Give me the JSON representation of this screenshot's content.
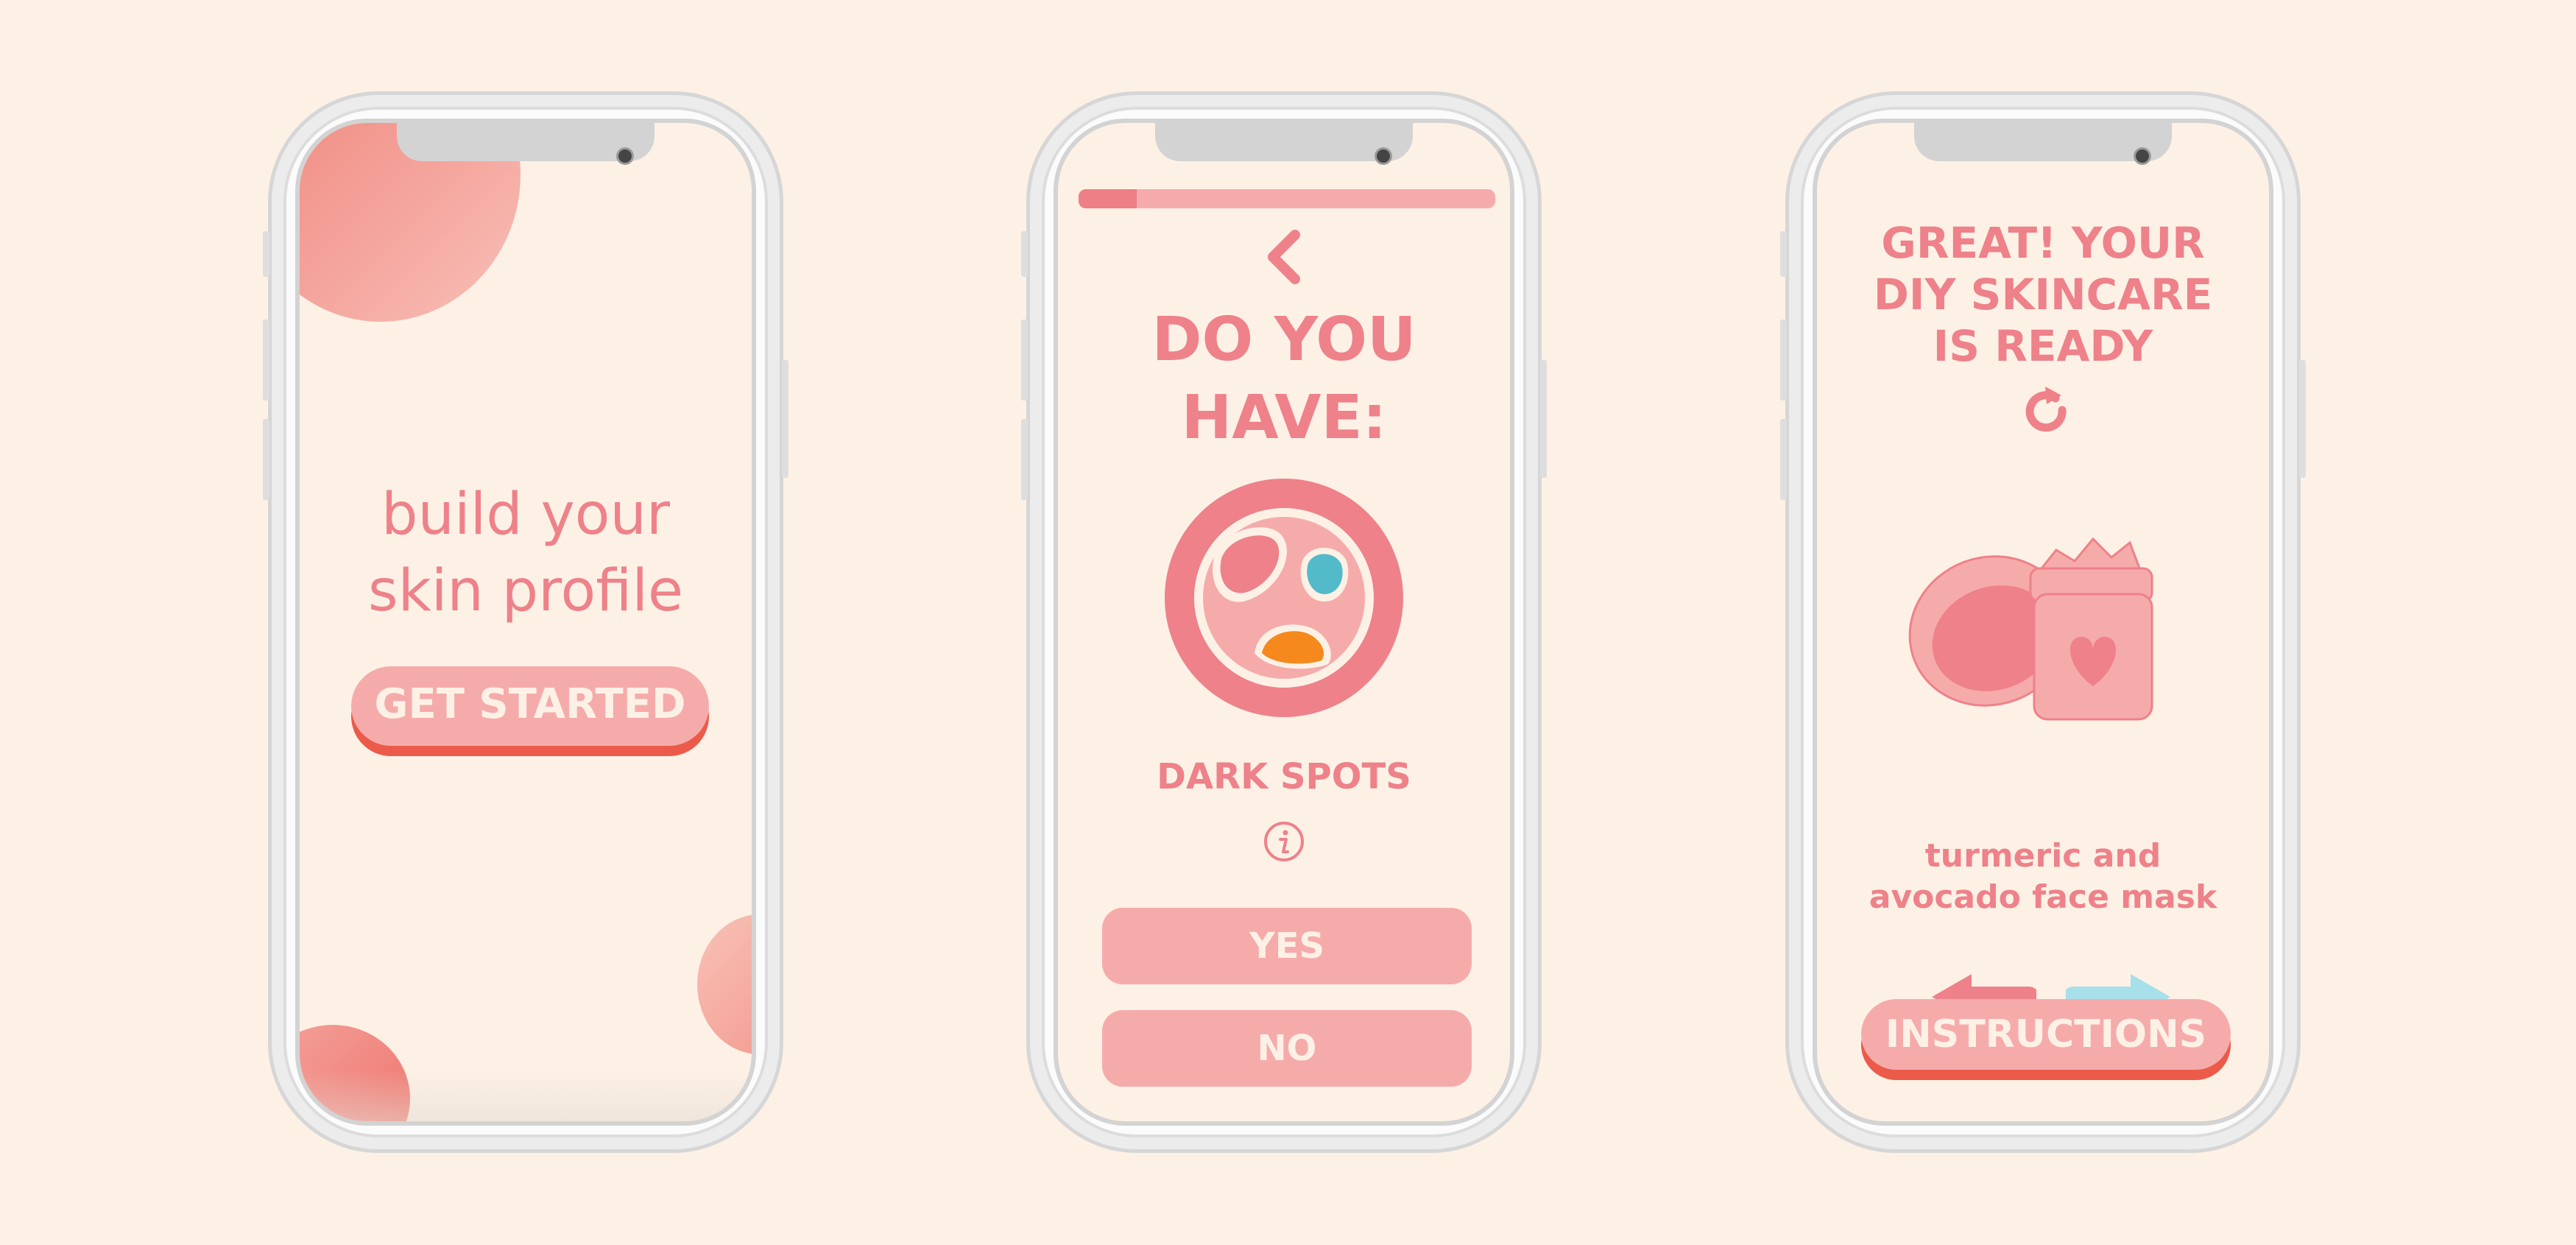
{
  "colors": {
    "background": "#fdf1e6",
    "primary_pink": "#ee8189",
    "light_pink": "#f6abab",
    "accent_red": "#ec5a4a",
    "accent_blue": "#a7dfea",
    "accent_orange": "#f5891e",
    "accent_teal": "#52bac9"
  },
  "screen1": {
    "headline_line1": "build your",
    "headline_line2": "skin profile",
    "cta_label": "GET STARTED"
  },
  "screen2": {
    "progress": 0.14,
    "back_icon": "chevron-left-icon",
    "question_line1": "DO YOU",
    "question_line2": "HAVE:",
    "illustration": "skin-spots-illustration",
    "condition_label": "DARK SPOTS",
    "info_icon": "info-icon",
    "yes_label": "YES",
    "no_label": "NO"
  },
  "screen3": {
    "headline_line1": "GREAT! YOUR",
    "headline_line2": "DIY SKINCARE",
    "headline_line3": "IS READY",
    "refresh_icon": "refresh-icon",
    "illustration": "face-mask-jar-illustration",
    "product_line1": "turmeric and",
    "product_line2": "avocado face mask",
    "prev_icon": "arrow-left-icon",
    "next_icon": "arrow-right-icon",
    "cta_label": "INSTRUCTIONS"
  }
}
